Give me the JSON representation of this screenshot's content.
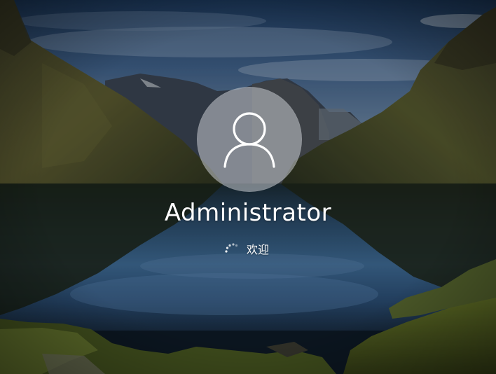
{
  "login": {
    "username": "Administrator",
    "status_text": "欢迎",
    "avatar_icon": "user-silhouette-icon",
    "spinner_icon": "loading-dots-spinner-icon"
  },
  "colors": {
    "text": "#ffffff",
    "avatar_fill": "#c8ccd2"
  }
}
